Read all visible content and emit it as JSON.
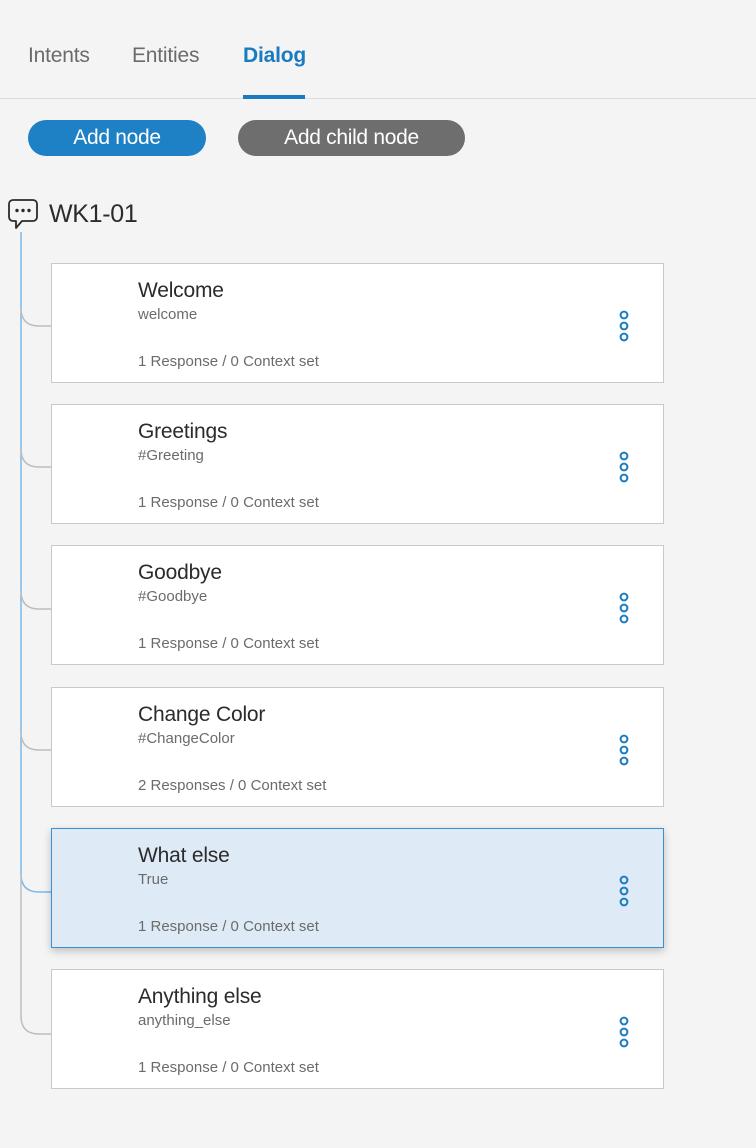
{
  "tabs": [
    {
      "label": "Intents"
    },
    {
      "label": "Entities"
    },
    {
      "label": "Dialog"
    }
  ],
  "active_tab": "Dialog",
  "toolbar": {
    "add_node_label": "Add node",
    "add_child_node_label": "Add child node"
  },
  "tree": {
    "root_title": "WK1-01",
    "root_icon": "chat-bubble-icon",
    "nodes": [
      {
        "title": "Welcome",
        "condition": "welcome",
        "summary": "1 Response / 0 Context set",
        "selected": false
      },
      {
        "title": "Greetings",
        "condition": "#Greeting",
        "summary": "1 Response / 0 Context set",
        "selected": false
      },
      {
        "title": "Goodbye",
        "condition": "#Goodbye",
        "summary": "1 Response / 0 Context set",
        "selected": false
      },
      {
        "title": "Change Color",
        "condition": "#ChangeColor",
        "summary": "2 Responses / 0 Context set",
        "selected": false
      },
      {
        "title": "What else",
        "condition": "True",
        "summary": "1 Response / 0 Context set",
        "selected": true
      },
      {
        "title": "Anything else",
        "condition": "anything_else",
        "summary": "1 Response / 0 Context set",
        "selected": false
      }
    ]
  },
  "colors": {
    "accent": "#1a7cc0",
    "primary_button": "#1e80c5",
    "secondary_button": "#6e6e6e",
    "selected_node_bg": "#deebf7",
    "tree_line_active": "#7db8ea",
    "tree_line": "#bdbdbd"
  }
}
